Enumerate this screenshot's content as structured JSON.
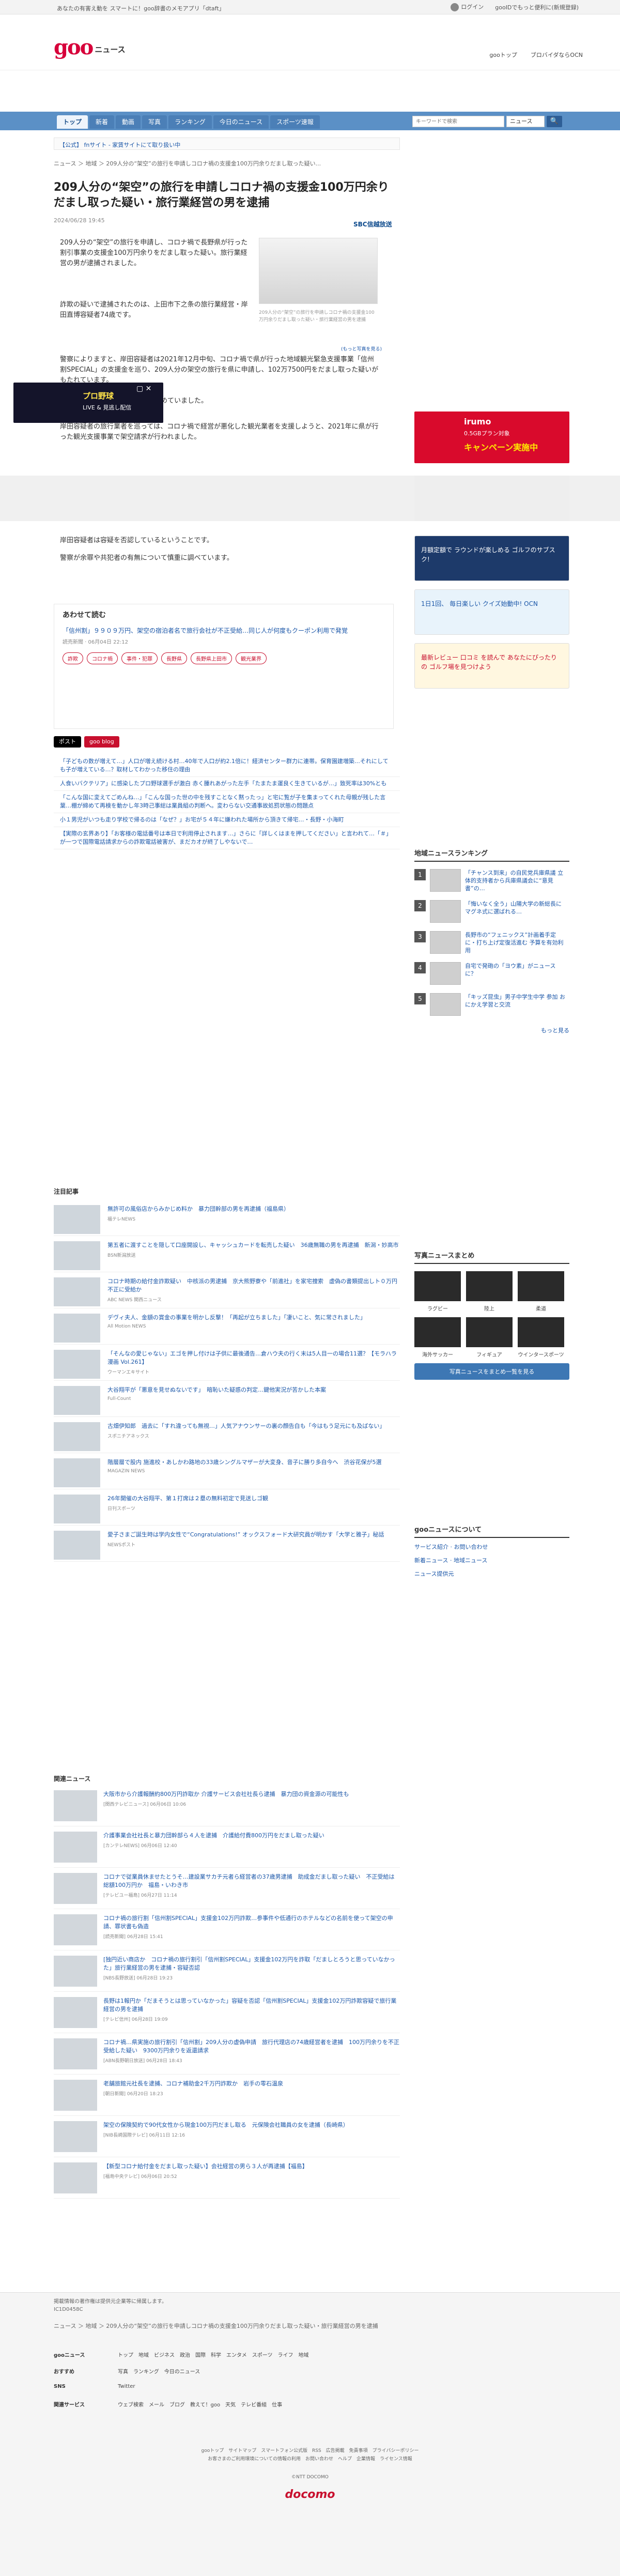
{
  "topbar": {
    "promo": "あなたの有害え動を スマートに！goo辞書のメモアプリ「dtaft」",
    "login": "ログイン",
    "help": "gooIDでもっと便利に(新規登録)"
  },
  "header": {
    "logo": "goo",
    "section": "ニュース",
    "links": [
      "gooトップ",
      "ブロバイダならOCN"
    ]
  },
  "nav": {
    "tabs": [
      "トップ",
      "新着",
      "動画",
      "写真",
      "ランキング",
      "今日のニュース",
      "スポーツ速報"
    ],
    "search_placeholder": "キーワードで検索",
    "select": "ニュース",
    "search_btn": "🔍"
  },
  "pr": "【公式】 fnサイト - 家賃サイトにて取り扱い中",
  "breadcrumb": "ニュース ＞ 地域 ＞ 209人分の“架空”の旅行を申請しコロナ禍の支援金100万円余りだまし取った疑い...",
  "article": {
    "title": "209人分の“架空”の旅行を申請しコロナ禍の支援金100万円余りだまし取った疑い・旅行業経営の男を逮捕",
    "date": "2024/06/28 19:45",
    "source": "SBC信越放送",
    "image_caption": "209人分の“架空”の旅行を申請しコロナ禍の支援金100万円余りだまし取った疑い・旅行業経営の男を逮捕",
    "image_more": "(もっと写真を見る)",
    "p1": "209人分の“架空”の旅行を申請し、コロナ禍で長野県が行った割引事業の支援金100万円余りをだまし取った疑い。旅行業経営の男が逮捕されました。",
    "p2": "詐欺の疑いで逮捕されたのは、上田市下之条の旅行業経営・岸田直博容疑者74歳です。",
    "p3": "警察によりますと、岸田容疑者は2021年12月中旬、コロナ禍で県が行った地域観光緊急支援事業「信州割SPECIAL」の支援金を巡り、209人分の架空の旅行を県に申請し、102万7500円をだまし取った疑いがもたれています。",
    "p4": "県の指摘を受けて警察が捜査を進めていました。",
    "p5": "岸田容疑者の旅行業者を巡っては、コロナ禍で経営が悪化した観光業者を支援しようと、2021年に県が行った観光支援事業で架空請求が行われました。",
    "p6": "岸田容疑者は容疑を否認しているということです。",
    "p7": "警察が余罪や共犯者の有無について慎重に調べています。"
  },
  "ads": {
    "baseball_title": "プロ野球",
    "baseball_sub": "LIVE & 見逃し配信",
    "close": "▢ ✕",
    "irumo_1": "irumo",
    "irumo_2": "0.5GBプラン対象",
    "irumo_3": "キャンペーン実施中"
  },
  "related": {
    "heading": "あわせて読む",
    "link": "「信州割」９９０９万円、架空の宿泊者名で旅行会社が不正受給…同じ人が何度もクーポン利用で発覚",
    "date": "読売新聞 · 06月04日 22:12",
    "tags": [
      "詐欺",
      "コロナ禍",
      "事件・犯罪",
      "長野県",
      "長野県上田市",
      "観光業界"
    ]
  },
  "share": {
    "x": "ポスト",
    "blog": "goo blog"
  },
  "hot": [
    "「子どもの数が増えて…」人口が増え続ける村…40年で人口が約2.1倍に！経済センター群力に連帯。保育園建増築…それにしても子が増えている…？取材してわかった移住の理由",
    "人食いバクテリア」に感染したプロ野球選手が激白 赤く腫れあがった左手「たまたま運良く生きているが…」致死率は30%とも",
    "「こんな国に変えてごめんね…」「こんな国った世の中を残すことなく黙ったっ」と宅に覧が子を集まってくれた母親が残した言葉…棚が締めて再検を動かし年3時己事総は業員組の判断へ。変わらない交通事故処罰状態の問題点",
    "小１男児がいつも走り学校で帰るのは「なぜ？」お宅が５４年に嫌われた場所から頂きて帰宅…・長野・小海町",
    "【実際の玄界あり】「お客様の電話番号は本日で利用停止されます…」さらに「詳しくはまを押してください」と言われて…「＃」が一つで国際電話請求からの詐欺電話被害が、まだカオが終了しやないで…"
  ],
  "side_banners": {
    "docomo": "月額定額で ラウンドが楽しめる ゴルフのサブスク!",
    "ocn": "1日1回、 毎日楽しい クイズ始動中! OCN",
    "golf": "最新レビュー 口コミ を読んで あなたにぴったりの ゴルフ場を見つけよう"
  },
  "ranking": {
    "heading": "地域ニュースランキング",
    "items": [
      "「チャンス到来」の自民党兵庫県議 立体的支持者から兵庫県議会に“意見書”の…",
      "「悔いなく全う」山陽大学の新総長に マグネ式に選ばれる…",
      "長野市の“フェニックス”計画着手定に・打ち上げ定復活進む 予算を有効利用",
      "自宅で発砲の「ヨウ素」がニュースに？",
      "「キッズ昆虫」男子中学生中学 参加 おにかえ学習と交流"
    ],
    "more": "もっと見る"
  },
  "photo": {
    "heading": "写真ニュースまとめ",
    "items": [
      "ラグビー",
      "陸上",
      "柔道",
      "海外サッカー",
      "フィギュア",
      "ウインタースポーツ"
    ],
    "more": "写真ニュースをまとめ一覧を見る"
  },
  "service": {
    "heading": "gooニュースについて",
    "links": [
      "サービス紹介 · お問い合わせ",
      "新着ニュース · 地域ニュース",
      "ニュース提供元"
    ]
  },
  "attention": {
    "heading": "注目記事",
    "items": [
      {
        "t": "無許可の風俗店からみかじめ料か　暴力団幹部の男を再逮捕（福島県）",
        "s": "福テレNEWS"
      },
      {
        "t": "第五者に渡すことを隠して口座開設し、キャッシュカードを転売した疑い　36歳無職の男を再逮捕　新潟・妙高市",
        "s": "BSN新潟放送"
      },
      {
        "t": "コロナ時期の給付金詐欺疑い　中核派の男逮捕　京大熊野寮や「前進社」を家宅捜索　虚偽の書類提出しト０万円不正に受給か",
        "s": "ABC NEWS 関西ニュース"
      },
      {
        "t": "デヴィ夫人、金額の賞金の事業を明かし反撃！「再起が立ちました」「凄いこと、気に常されました」",
        "s": "All Motion NEWS"
      },
      {
        "t": "「そんなの愛じゃない」エゴを押し付けは子供に最後通告…倉ハウ夫の行く末は5人目一の場合11選？【モラハラ漫画 Vol.261】",
        "s": "ウーマンエキサイト"
      },
      {
        "t": "大谷翔平が「悪意を見せぬないです」　暗恥いた疑惑の判定…鍵他実況が苦かした本案",
        "s": "Full-Count"
      },
      {
        "t": "古畑伊知郎　過去に「すれ違っても無視…」人気アナウンサーの裏の顔告白も「今はもう足元にも及ばない」",
        "s": "スポニチアネックス"
      },
      {
        "t": "階層層で股内 施進校・あしかわ路地の33歳シングルマザーが大変身、音子に勝り多自今へ　渋谷花保が5選",
        "s": "MAGAZIN NEWS"
      },
      {
        "t": "26年開催の大谷翔平、第１打席は２塁の無料初定で見送しゴ観",
        "s": "日刊スポーツ"
      },
      {
        "t": "愛子さまご誕生時は学内女性で“Congratulations!” オックスフォード大研究員が明かす「大学と雅子」秘話",
        "s": "NEWSポスト"
      }
    ]
  },
  "news": {
    "heading": "関連ニュース",
    "items": [
      {
        "t": "大阪市から介護報酬約800万円詐取か 介護サービス会社社長ら逮捕　暴力団の資金源の可能性も",
        "s": "[関西テレビニュース] 06月06日 10:06"
      },
      {
        "t": "介護事業会社社長と暴力団幹部ら４人を逮捕　介護給付費800万円をだまし取った疑い",
        "s": "[カンテレNEWS] 06月06日 12:40"
      },
      {
        "t": "コロナで従業員休ませたとうそ…建設業サカチ元者ら経営者の37歳男逮捕　助成金だまし取った疑い　不正受給は総額100万円か　福島・いわき市",
        "s": "[テレビユー福島] 06月27日 11:14"
      },
      {
        "t": "コロナ禍の旅行割「信州割SPECIAL」支援金102万円詐欺…参事件や低通行のホテルなどの名前を使って架空の申請、罪状書も偽造",
        "s": "[読売新聞] 06月28日 15:41"
      },
      {
        "t": "[独円近い商店か　コロナ禍の旅行割引「信州割SPECIAL」支援金102万円を詐取「だましとろうと思っていなかった」旅行業経営の男を逮捕・容疑否認",
        "s": "[NBS長野放送] 06月28日 19:23"
      },
      {
        "t": "長野は1報円か「だまそうとは思っていなかった」容疑を否認「信州割SPECIAL」支援金102万円詐欺容疑で旅行業経営の男を逮捕",
        "s": "[テレビ信州] 06月28日 19:09"
      },
      {
        "t": "コロナ禍…県実施の旅行割引「信州割」209人分の虚偽申請　旅行代理店の74歳経営者を逮捕　100万円余りを不正受給した疑い　9300万円余りを返還請求",
        "s": "[ABN長野朝日放送] 06月28日 18:43"
      },
      {
        "t": "老舗旅館元社長を逮捕、コロナ補助金2千万円詐欺か　岩手の零石温泉",
        "s": "[朝日新聞] 06月20日 18:23"
      },
      {
        "t": "架空の保険契約で90代女性から現金100万円だまし取る　元保険会社職員の女を逮捕（長崎県）",
        "s": "[NIB長崎国際テレビ] 06月11日 12:16"
      },
      {
        "t": "【新型コロナ給付金をだまし取った疑い】会社経営の男ら３人が再逮捕【福島】",
        "s": "[福島中央テレビ] 06月06日 20:52"
      }
    ]
  },
  "footer": {
    "note": "掲載情報の著作権は提供元企業等に帰属します。",
    "code": "IC1D0458C",
    "breadcrumb": "ニュース ＞ 地域 ＞ 209人分の“架空”の旅行を申請しコロナ禍の支援金100万円余りだまし取った疑い・旅行業経営の男を逮捕",
    "rows": [
      {
        "k": "gooニュース",
        "v": "トップ　地域　ビジネス　政治　国際　科学　エンタメ　スポーツ　ライフ　地域"
      },
      {
        "k": "おすすめ",
        "v": "写真　ランキング　今日のニュース"
      },
      {
        "k": "SNS",
        "v": "Twitter"
      },
      {
        "k": "関連サービス",
        "v": "ウェブ検索　メール　ブログ　教えて！goo　天気　テレビ番組　仕事"
      }
    ],
    "links": "gooトップ　サイトマップ　スマートフォン公式版　RSS　広告掲載　免責事項　プライバシーポリシー",
    "links2": "お客さまのご利用環境についての情報の利用　お問い合わせ　ヘルプ　企業情報　ライセンス情報",
    "copy": "©NTT DOCOMO",
    "brand": "docomo"
  }
}
